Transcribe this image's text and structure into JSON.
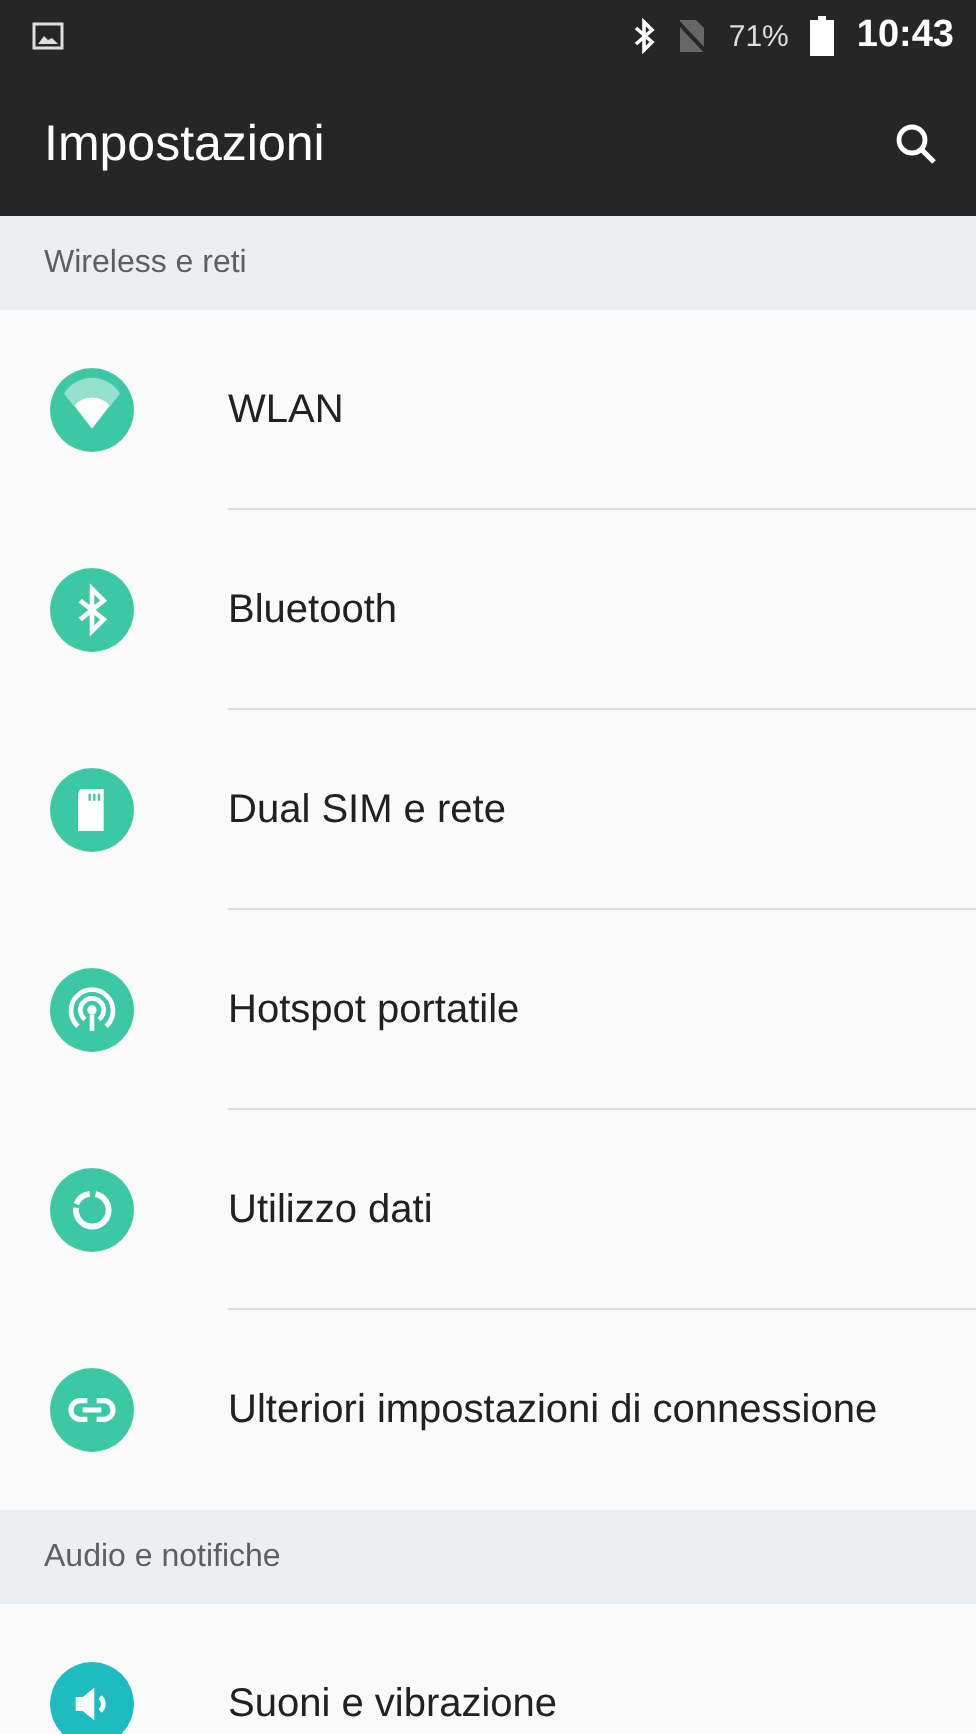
{
  "status_bar": {
    "battery": "71%",
    "time": "10:43"
  },
  "app_bar": {
    "title": "Impostazioni"
  },
  "sections": [
    {
      "title": "Wireless e reti",
      "items": [
        {
          "label": "WLAN",
          "color": "#3cc8a4"
        },
        {
          "label": "Bluetooth",
          "color": "#3cc8a4"
        },
        {
          "label": "Dual SIM e rete",
          "color": "#3cc8a4"
        },
        {
          "label": "Hotspot portatile",
          "color": "#3cc8a4"
        },
        {
          "label": "Utilizzo dati",
          "color": "#3cc8a4"
        },
        {
          "label": "Ulteriori impostazioni di connessione",
          "color": "#3cc8a4"
        }
      ]
    },
    {
      "title": "Audio e notifiche",
      "items": [
        {
          "label": "Suoni e vibrazione",
          "color": "#1ebcc0"
        }
      ]
    }
  ]
}
